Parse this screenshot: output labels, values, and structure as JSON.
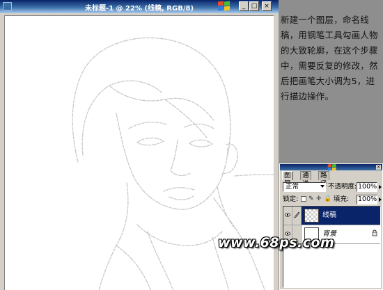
{
  "document_window": {
    "title": "未标题-1 @ 22% (线稿, RGB/8)",
    "minimize_label": "_",
    "maximize_label": "□",
    "close_label": "×"
  },
  "instructions": {
    "text": "新建一个图层，命名线稿，用钢笔工具勾画人物的大致轮廓，在这个步骤中，需要反复的修改，然后把画笔大小调为5，进行描边操作。"
  },
  "layers_panel": {
    "tabs": [
      "图层",
      "通道",
      "路径"
    ],
    "active_tab": "图层",
    "close_label": "×",
    "blend_mode": "正常",
    "opacity_label": "不透明度:",
    "opacity_value": "100%",
    "lock_label": "锁定:",
    "fill_label": "填充:",
    "fill_value": "100%",
    "layers": [
      {
        "name": "线稿",
        "selected": true,
        "visible": true,
        "thumbnail": "transparent-checker"
      },
      {
        "name": "背景",
        "selected": false,
        "visible": true,
        "thumbnail": "white",
        "locked": true
      }
    ]
  },
  "watermark": {
    "text": "www.68ps.com"
  }
}
